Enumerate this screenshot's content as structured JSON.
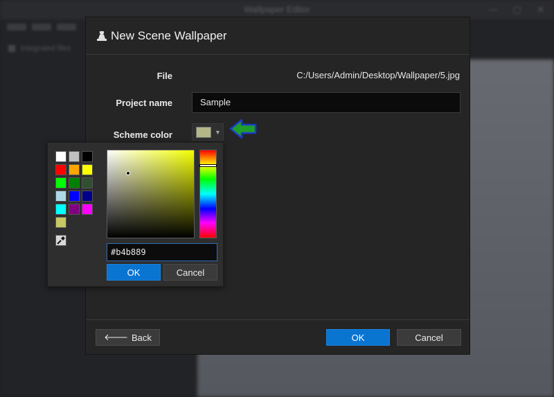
{
  "app": {
    "window_title": "Wallpaper Editor",
    "side_item": "Integrated files"
  },
  "dialog": {
    "title": "New Scene Wallpaper",
    "file_label": "File",
    "file_value": "C:/Users/Admin/Desktop/Wallpaper/5.jpg",
    "project_label": "Project name",
    "project_value": "Sample",
    "scheme_label": "Scheme color",
    "scheme_color": "#b4b889",
    "back_label": "Back",
    "ok_label": "OK",
    "cancel_label": "Cancel"
  },
  "picker": {
    "presets": [
      "#ffffff",
      "#c0c0c0",
      "#000000",
      "#ff0000",
      "#ffa500",
      "#ffff00",
      "#00ff00",
      "#008000",
      "#2f4f2f",
      "#add8e6",
      "#0000ff",
      "#00008b",
      "#00ffff",
      "#800080",
      "#ff00ff",
      "#c8c864"
    ],
    "hex_value": "#b4b889",
    "ok_label": "OK",
    "cancel_label": "Cancel",
    "eyedropper_icon": "eyedropper-icon"
  },
  "colors": {
    "accent": "#0a74d1",
    "dialog_bg": "#252525",
    "arrow": "#1f9e2a"
  }
}
